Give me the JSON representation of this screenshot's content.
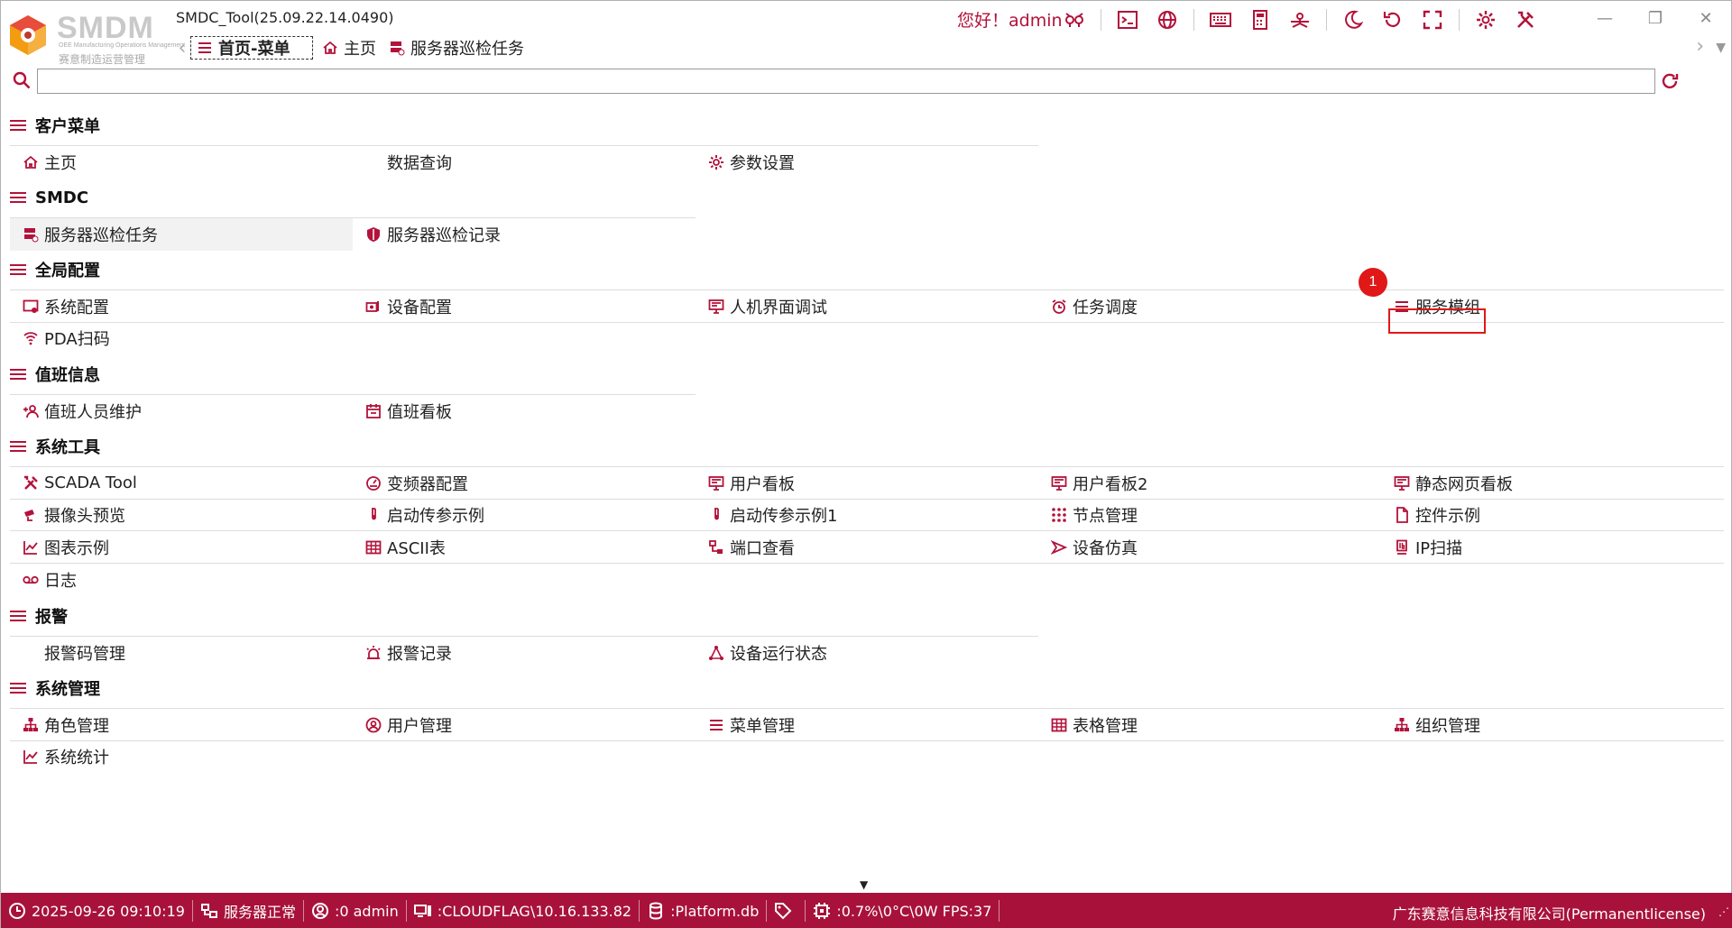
{
  "app": {
    "title": "SMDC_Tool(25.09.22.14.0490)",
    "logo_text": "SMDM",
    "logo_subtitle_en": "OEE Manufacturing Operations Management",
    "logo_subtitle_cn": "赛意制造运营管理"
  },
  "tabs": [
    {
      "label": "首页-菜单",
      "icon": "menu-icon",
      "active": true
    },
    {
      "label": "主页",
      "icon": "home-icon",
      "active": false
    },
    {
      "label": "服务器巡检任务",
      "icon": "server-icon",
      "active": false
    }
  ],
  "header": {
    "greeting": "您好！admin"
  },
  "toolbar": [
    "user-switch-icon",
    "terminal-icon",
    "globe-icon",
    "keyboard-icon",
    "calculator-icon",
    "network-icon",
    "night-mode-icon",
    "refresh-icon",
    "fullscreen-icon",
    "gear-icon",
    "tools-icon"
  ],
  "window_controls": {
    "minimize": "—",
    "restore": "❐",
    "close": "✕"
  },
  "search": {
    "placeholder": "",
    "value": ""
  },
  "sections": [
    {
      "title": "客户菜单",
      "rows": [
        [
          {
            "label": "主页",
            "icon": "home-icon"
          },
          {
            "label": "数据查询",
            "icon": ""
          },
          {
            "label": "参数设置",
            "icon": "gear-icon"
          }
        ]
      ]
    },
    {
      "title": "SMDC",
      "rows": [
        [
          {
            "label": "服务器巡检任务",
            "icon": "server-icon",
            "selected": true
          },
          {
            "label": "服务器巡检记录",
            "icon": "shield-icon"
          }
        ]
      ]
    },
    {
      "title": "全局配置",
      "rows": [
        [
          {
            "label": "系统配置",
            "icon": "system-config-icon"
          },
          {
            "label": "设备配置",
            "icon": "device-config-icon"
          },
          {
            "label": "人机界面调试",
            "icon": "monitor-icon"
          },
          {
            "label": "任务调度",
            "icon": "alarm-clock-icon"
          },
          {
            "label": "服务模组",
            "icon": "menu-icon"
          }
        ],
        [
          {
            "label": "PDA扫码",
            "icon": "wifi-icon"
          }
        ]
      ]
    },
    {
      "title": "值班信息",
      "rows": [
        [
          {
            "label": "值班人员维护",
            "icon": "user-add-icon"
          },
          {
            "label": "值班看板",
            "icon": "calendar-icon"
          }
        ]
      ]
    },
    {
      "title": "系统工具",
      "rows": [
        [
          {
            "label": "SCADA Tool",
            "icon": "tools-icon"
          },
          {
            "label": "变频器配置",
            "icon": "gauge-icon"
          },
          {
            "label": "用户看板",
            "icon": "monitor-icon"
          },
          {
            "label": "用户看板2",
            "icon": "monitor-icon"
          },
          {
            "label": "静态网页看板",
            "icon": "monitor-icon"
          }
        ],
        [
          {
            "label": "摄像头预览",
            "icon": "camera-icon"
          },
          {
            "label": "启动传参示例",
            "icon": "test-tube-icon"
          },
          {
            "label": "启动传参示例1",
            "icon": "test-tube-icon"
          },
          {
            "label": "节点管理",
            "icon": "grid-dots-icon"
          },
          {
            "label": "控件示例",
            "icon": "file-icon"
          }
        ],
        [
          {
            "label": "图表示例",
            "icon": "line-chart-icon"
          },
          {
            "label": "ASCII表",
            "icon": "table-icon"
          },
          {
            "label": "端口查看",
            "icon": "port-icon"
          },
          {
            "label": "设备仿真",
            "icon": "play-outline-icon"
          },
          {
            "label": "IP扫描",
            "icon": "ip-icon"
          }
        ],
        [
          {
            "label": "日志",
            "icon": "voicemail-icon"
          }
        ]
      ]
    },
    {
      "title": "报警",
      "rows": [
        [
          {
            "label": "报警码管理",
            "icon": ""
          },
          {
            "label": "报警记录",
            "icon": "siren-icon"
          },
          {
            "label": "设备运行状态",
            "icon": "nodes-icon"
          }
        ]
      ]
    },
    {
      "title": "系统管理",
      "rows": [
        [
          {
            "label": "角色管理",
            "icon": "org-icon"
          },
          {
            "label": "用户管理",
            "icon": "user-circle-icon"
          },
          {
            "label": "菜单管理",
            "icon": "menu-icon"
          },
          {
            "label": "表格管理",
            "icon": "table-icon"
          },
          {
            "label": "组织管理",
            "icon": "org-icon"
          }
        ],
        [
          {
            "label": "系统统计",
            "icon": "line-chart-icon"
          }
        ]
      ]
    }
  ],
  "annotation": {
    "badge": "1"
  },
  "statusbar": {
    "datetime": "2025-09-26 09:10:19",
    "server_status": "服务器正常",
    "user": ":0 admin",
    "host": ":CLOUDFLAG\\10.16.133.82",
    "database": ":Platform.db",
    "perf": ":0.7%\\0°C\\0W  FPS:37",
    "company": "广东赛意信息科技有限公司(Permanentlicense)"
  },
  "colors": {
    "accent": "#b3123a",
    "statusbar": "#a8123a",
    "highlight": "#e01818"
  }
}
